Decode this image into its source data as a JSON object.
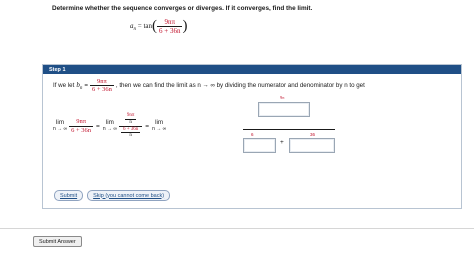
{
  "question": {
    "prompt": "Determine whether the sequence converges or diverges. If it converges, find the limit.",
    "sequence": {
      "lhs": "a",
      "lhs_sub": "n",
      "equals": "=",
      "func": "tan",
      "numerator": "9nπ",
      "denominator": "6 + 36n"
    }
  },
  "step": {
    "header": "Step 1",
    "intro_prefix": "If we let",
    "b_var": "b",
    "b_sub": "n",
    "equals": "=",
    "b_numerator": "9nπ",
    "b_denominator": "6 + 36n",
    "intro_suffix": ", then we can find the limit as n → ∞ by dividing the numerator and denominator by n to get",
    "lim_word": "lim",
    "lim_under": "n → ∞",
    "frac1_numerator": "9nπ",
    "frac1_denominator": "6 + 36n",
    "frac2_top_numerator": "9nπ",
    "frac2_top_denominator": "n",
    "frac2_bottom_numerator": "6 + 36n",
    "frac2_bottom_denominator": "n",
    "big_numerator_hint": "9π",
    "big_left_label": "6",
    "big_right_label": "36",
    "plus": "+",
    "answer_top": "",
    "answer_left": "",
    "answer_right": ""
  },
  "buttons": {
    "submit": "Submit",
    "skip": "Skip (you cannot come back)",
    "submit_answer": "Submit Answer"
  },
  "colors": {
    "accent": "#c0102a",
    "header_bg": "#1f4f86"
  }
}
